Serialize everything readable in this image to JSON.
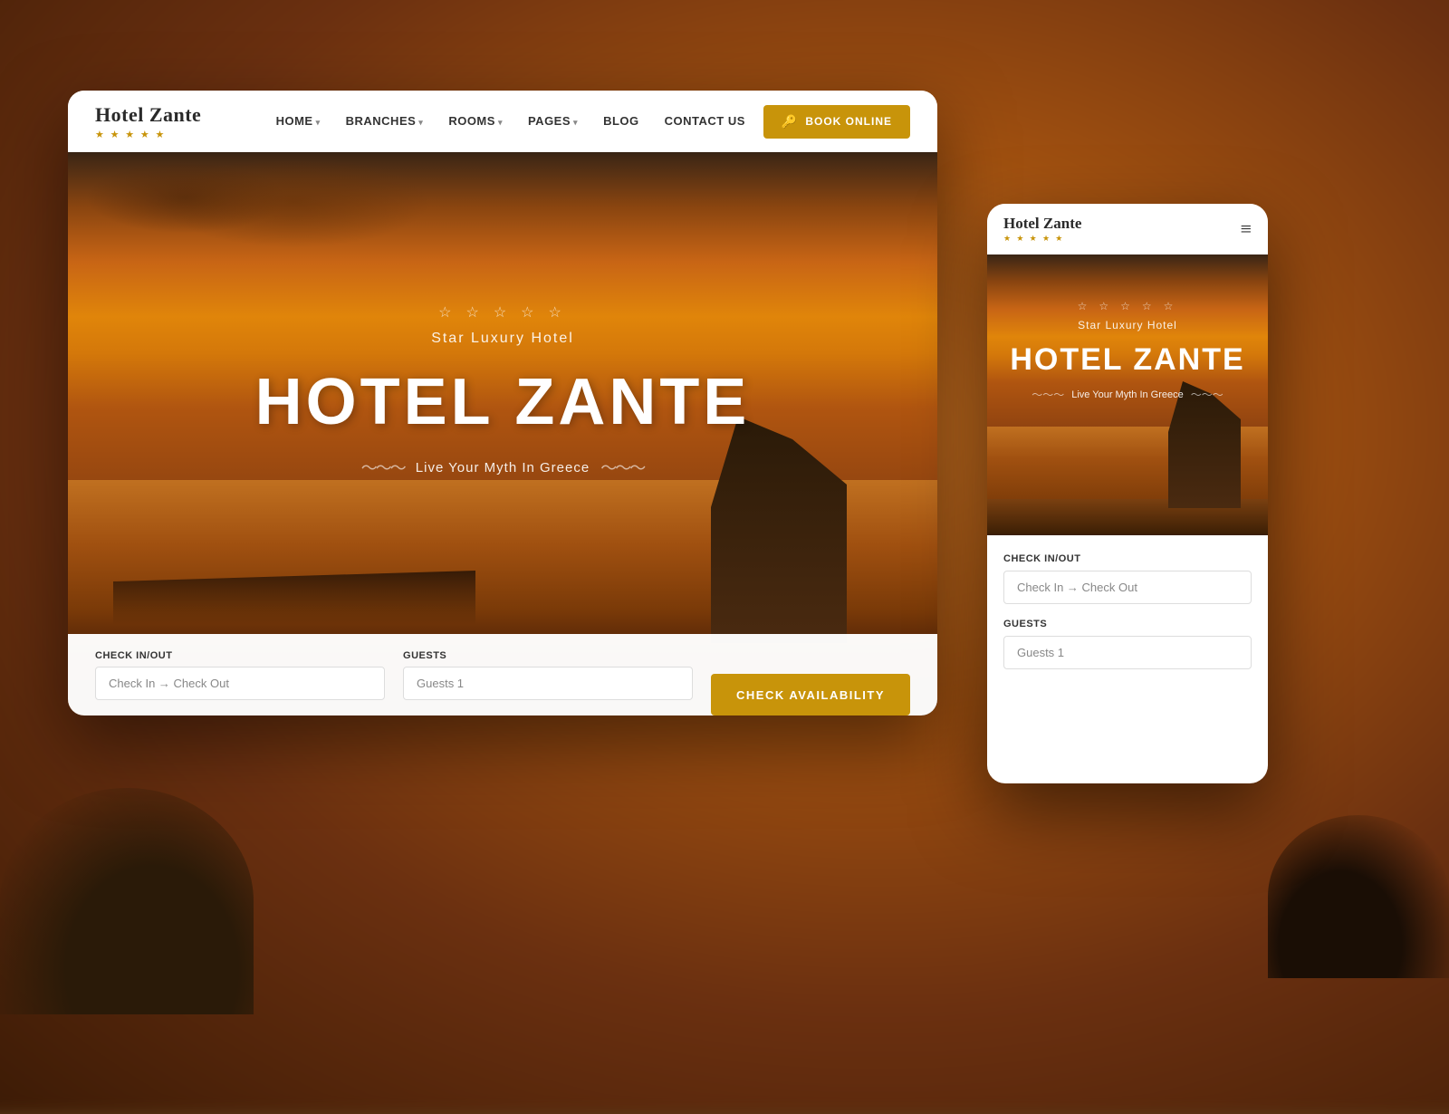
{
  "page": {
    "bg_color": "#5a3a1a"
  },
  "desktop": {
    "logo": {
      "name": "Hotel Zante",
      "stars": "★ ★ ★ ★ ★"
    },
    "nav": {
      "items": [
        {
          "label": "HOME",
          "has_dropdown": true
        },
        {
          "label": "BRANCHES",
          "has_dropdown": true
        },
        {
          "label": "ROOMS",
          "has_dropdown": true
        },
        {
          "label": "PAGES",
          "has_dropdown": true
        },
        {
          "label": "BLOG",
          "has_dropdown": false
        },
        {
          "label": "CONTACT US",
          "has_dropdown": false
        }
      ],
      "book_button": "BOOK ONLINE"
    },
    "hero": {
      "stars": "☆ ☆ ☆ ☆ ☆",
      "subtitle": "Star Luxury Hotel",
      "title": "HOTEL ZANTE",
      "wave_left": "〜〜〜",
      "tagline": "Live Your Myth In Greece",
      "wave_right": "〜〜〜"
    },
    "booking": {
      "checkin_label": "Check In/Out",
      "checkin_placeholder": "Check In → Check Out",
      "guests_label": "Guests",
      "guests_placeholder": "Guests 1",
      "btn_label": "CHECK AVAILABILITY"
    }
  },
  "mobile": {
    "logo": {
      "name": "Hotel Zante",
      "stars": "★ ★ ★ ★ ★"
    },
    "hamburger": "≡",
    "hero": {
      "stars": "☆ ☆ ☆ ☆ ☆",
      "subtitle": "Star Luxury Hotel",
      "title": "HOTEL ZANTE",
      "wave_left": "〜〜〜",
      "tagline": "Live Your Myth In Greece",
      "wave_right": "〜〜〜"
    },
    "booking": {
      "checkin_label": "Check In/Out",
      "checkin_placeholder": "Check In → Check Out",
      "guests_label": "Guests",
      "guests_placeholder": "Guests 1"
    }
  }
}
